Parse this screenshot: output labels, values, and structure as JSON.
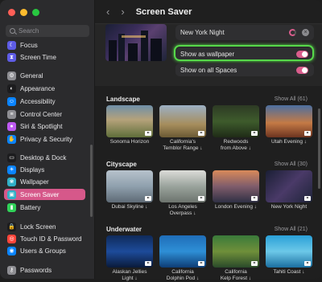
{
  "window": {
    "traffic_colors": [
      "#ff5f57",
      "#febc2e",
      "#28c840"
    ]
  },
  "search": {
    "placeholder": "Search"
  },
  "sidebar": {
    "items": [
      {
        "label": "Focus",
        "color": "#5e5ce6",
        "icon": "moon-icon"
      },
      {
        "label": "Screen Time",
        "color": "#5e5ce6",
        "icon": "hourglass-icon"
      },
      {
        "label": "General",
        "color": "#8e8e93",
        "icon": "gear-icon"
      },
      {
        "label": "Appearance",
        "color": "#1c1c1e",
        "icon": "appearance-icon"
      },
      {
        "label": "Accessibility",
        "color": "#0a84ff",
        "icon": "accessibility-icon"
      },
      {
        "label": "Control Center",
        "color": "#8e8e93",
        "icon": "control-center-icon"
      },
      {
        "label": "Siri & Spotlight",
        "color": "#bf5af2",
        "icon": "siri-icon"
      },
      {
        "label": "Privacy & Security",
        "color": "#0a84ff",
        "icon": "hand-icon"
      },
      {
        "label": "Desktop & Dock",
        "color": "#1c1c1e",
        "icon": "dock-icon"
      },
      {
        "label": "Displays",
        "color": "#0a84ff",
        "icon": "display-icon"
      },
      {
        "label": "Wallpaper",
        "color": "#30b0c7",
        "icon": "wallpaper-icon"
      },
      {
        "label": "Screen Saver",
        "color": "#30b0c7",
        "icon": "screen-saver-icon"
      },
      {
        "label": "Battery",
        "color": "#30d158",
        "icon": "battery-icon"
      },
      {
        "label": "Lock Screen",
        "color": "#1c1c1e",
        "icon": "lock-icon"
      },
      {
        "label": "Touch ID & Password",
        "color": "#ff453a",
        "icon": "fingerprint-icon"
      },
      {
        "label": "Users & Groups",
        "color": "#0a84ff",
        "icon": "users-icon"
      },
      {
        "label": "Passwords",
        "color": "#8e8e93",
        "icon": "key-icon"
      }
    ]
  },
  "header": {
    "title": "Screen Saver",
    "back": "‹",
    "forward": "›"
  },
  "settings": {
    "selected_name": "New York Night",
    "show_as_wallpaper": "Show as wallpaper",
    "show_on_all_spaces": "Show on all Spaces"
  },
  "sections": [
    {
      "title": "Landscape",
      "show_all": "Show All (61)",
      "items": [
        "Sonoma Horizon",
        "California's\nTemblor Range ↓",
        "Redwoods\nfrom Above ↓",
        "Utah Evening ↓"
      ]
    },
    {
      "title": "Cityscape",
      "show_all": "Show All (30)",
      "items": [
        "Dubai Skyline ↓",
        "Los Angeles\nOverpass ↓",
        "London Evening ↓",
        "New York Night"
      ]
    },
    {
      "title": "Underwater",
      "show_all": "Show All (21)",
      "items": [
        "Alaskan Jellies\nLight ↓",
        "California\nDolphin Pod ↓",
        "California\nKelp Forest ↓",
        "Tahiti Coast ↓"
      ]
    }
  ],
  "accent": "#d95d8c",
  "highlight_color": "#57d94a"
}
